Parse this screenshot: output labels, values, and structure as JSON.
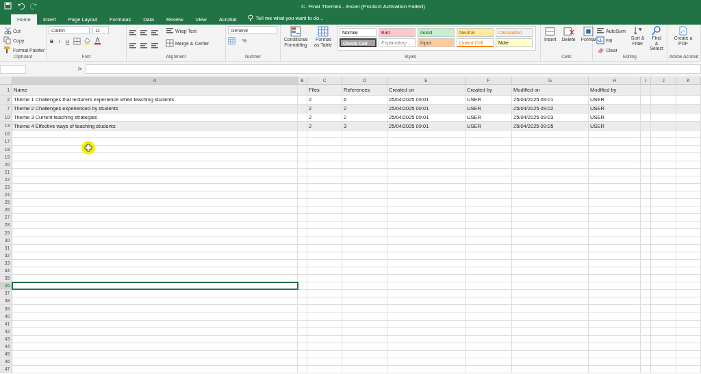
{
  "window": {
    "title": "C. Final Themes - Excel (Product Activation Failed)"
  },
  "tabs": [
    {
      "label": "Home",
      "selected": true
    },
    {
      "label": "Insert",
      "selected": false
    },
    {
      "label": "Page Layout",
      "selected": false
    },
    {
      "label": "Formulas",
      "selected": false
    },
    {
      "label": "Data",
      "selected": false
    },
    {
      "label": "Review",
      "selected": false
    },
    {
      "label": "View",
      "selected": false
    },
    {
      "label": "Acrobat",
      "selected": false
    }
  ],
  "tell_me": {
    "placeholder": "Tell me what you want to do..."
  },
  "ribbon": {
    "clipboard": {
      "label": "Clipboard",
      "items": [
        "Cut",
        "Copy",
        "Format Painter"
      ]
    },
    "font": {
      "label": "Font",
      "font_name": "Calibri",
      "font_size": "11",
      "buttons": [
        "B",
        "I",
        "U"
      ]
    },
    "alignment": {
      "label": "Alignment",
      "wrap": "Wrap Text",
      "merge": "Merge & Center"
    },
    "number": {
      "label": "Number",
      "format": "General",
      "percent": "%"
    },
    "styles": {
      "label": "Styles",
      "conditional": "Conditional Formatting",
      "format_table": "Format as Table",
      "cell_styles": [
        {
          "name": "Normal",
          "kind": "normal",
          "color": "#ffffff"
        },
        {
          "name": "Bad",
          "kind": "bad",
          "color": "#ffc7ce"
        },
        {
          "name": "Good",
          "kind": "good",
          "color": "#c6efce"
        },
        {
          "name": "Neutral",
          "kind": "neutral",
          "color": "#ffeb9c"
        },
        {
          "name": "Calculation",
          "kind": "calculation",
          "color": "#f2f2f2"
        },
        {
          "name": "Check Cell",
          "kind": "check",
          "color": "#a5a5a5"
        },
        {
          "name": "Explanatory ...",
          "kind": "explanatory",
          "color": "#ffffff"
        },
        {
          "name": "Input",
          "kind": "input",
          "color": "#ffcc99"
        },
        {
          "name": "Linked Cell",
          "kind": "linked",
          "color": "#ffffff"
        },
        {
          "name": "Note",
          "kind": "note",
          "color": "#ffffcc"
        }
      ]
    },
    "cells": {
      "label": "Cells",
      "items": [
        "Insert",
        "Delete",
        "Format"
      ]
    },
    "editing": {
      "label": "Editing",
      "autosum": "AutoSum",
      "fill": "Fill",
      "clear": "Clear",
      "sort": "Sort & Filter",
      "find": "Find & Select"
    },
    "acrobat": {
      "label": "Adobe Acrobat",
      "create": "Create a PDF"
    }
  },
  "formula_bar": {
    "fx": "fx"
  },
  "sheet": {
    "columns": [
      "A",
      "B",
      "C",
      "D",
      "E",
      "F",
      "G",
      "H",
      "I",
      "J",
      "K"
    ],
    "rows": [
      {
        "number": "1",
        "selected": false,
        "shaded": true,
        "cells": {
          "A": "Name",
          "C": "Files",
          "D": "References",
          "E": "Created on",
          "F": "Created by",
          "G": "Modified on",
          "H": "Modified by"
        }
      },
      {
        "number": "2",
        "selected": false,
        "shaded": false,
        "cells": {
          "A": "Theme 1 Challenges that lecturers experience when teaching students",
          "C": "2",
          "D": "6",
          "E": "25/04/2025 09:01",
          "F": "USER",
          "G": "25/04/2025 09:01",
          "H": "USER"
        }
      },
      {
        "number": "7",
        "selected": false,
        "shaded": true,
        "cells": {
          "A": "Theme 2 Challenges experienced by students",
          "C": "2",
          "D": "2",
          "E": "25/04/2025 09:01",
          "F": "USER",
          "G": "25/04/2025 09:02",
          "H": "USER"
        }
      },
      {
        "number": "10",
        "selected": false,
        "shaded": false,
        "cells": {
          "A": "Theme 3 Current teaching strategies",
          "C": "2",
          "D": "2",
          "E": "25/04/2025 09:01",
          "F": "USER",
          "G": "25/04/2025 09:03",
          "H": "USER"
        }
      },
      {
        "number": "13",
        "selected": false,
        "shaded": true,
        "cells": {
          "A": "Theme 4 Effective ways of teaching students",
          "C": "2",
          "D": "3",
          "E": "25/04/2025 09:01",
          "F": "USER",
          "G": "25/04/2025 09:05",
          "H": "USER"
        }
      },
      {
        "number": "16",
        "selected": false
      },
      {
        "number": "17",
        "selected": false
      },
      {
        "number": "18",
        "selected": false
      },
      {
        "number": "19",
        "selected": false
      },
      {
        "number": "20",
        "selected": false
      },
      {
        "number": "21",
        "selected": false
      },
      {
        "number": "22",
        "selected": false
      },
      {
        "number": "23",
        "selected": false
      },
      {
        "number": "24",
        "selected": false
      },
      {
        "number": "25",
        "selected": false
      },
      {
        "number": "26",
        "selected": false
      },
      {
        "number": "27",
        "selected": false
      },
      {
        "number": "28",
        "selected": false
      },
      {
        "number": "29",
        "selected": false
      },
      {
        "number": "30",
        "selected": false
      },
      {
        "number": "31",
        "selected": false
      },
      {
        "number": "32",
        "selected": false
      },
      {
        "number": "33",
        "selected": false
      },
      {
        "number": "34",
        "selected": false
      },
      {
        "number": "35",
        "selected": false
      },
      {
        "number": "36",
        "selected": true
      },
      {
        "number": "37",
        "selected": false
      },
      {
        "number": "38",
        "selected": false
      },
      {
        "number": "39",
        "selected": false
      },
      {
        "number": "40",
        "selected": false
      },
      {
        "number": "41",
        "selected": false
      },
      {
        "number": "42",
        "selected": false
      },
      {
        "number": "43",
        "selected": false
      },
      {
        "number": "44",
        "selected": false
      },
      {
        "number": "45",
        "selected": false
      },
      {
        "number": "46",
        "selected": false
      },
      {
        "number": "47",
        "selected": false
      }
    ]
  }
}
